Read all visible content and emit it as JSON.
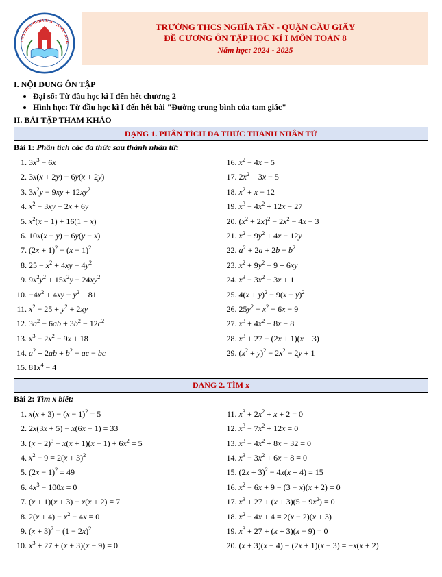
{
  "header": {
    "school_line": "TRƯỜNG THCS NGHĨA TÂN -  QUẬN CẦU GIẤY",
    "doc_line": "ĐỀ CƯƠNG ÔN TẬP HỌC KÌ I MÔN TOÁN 8",
    "year_line": "Năm học: 2024 - 2025",
    "logo_text_top": "TRƯỜNG THCS NGHĨA TÂN - QUẬN CẦU GIẤY"
  },
  "sections": {
    "s1_title": "I. NỘI DUNG ÔN TẬP",
    "s1_bullets": [
      "Đại số: Từ đầu học kì I đến hết chương 2",
      "Hình học: Từ đầu học kì I đến hết bài \"Đường trung bình của tam giác\""
    ],
    "s2_title": "II. BÀI TẬP THAM KHẢO"
  },
  "dang1": {
    "bar": "DẠNG 1. PHÂN TÍCH ĐA THỨC THÀNH NHÂN TỬ",
    "bai_label": "Bài 1:",
    "bai_text": "Phân tích các đa thức sau thành nhân tử:",
    "left": [
      "3x³ − 6x",
      "3x(x + 2y) − 6y(x + 2y)",
      "3x²y − 9xy + 12xy²",
      "x² − 3xy − 2x + 6y",
      "x²(x − 1) + 16(1 − x)",
      "10x(x − y) − 6y(y − x)",
      "(2x + 1)² − (x − 1)²",
      "25 − x² + 4xy − 4y²",
      "9x²y² + 15x²y − 24xy²",
      "−4x² + 4xy − y² + 81",
      "x² − 25 + y² + 2xy",
      "3a² − 6ab + 3b² − 12c²",
      "x³ − 2x² − 9x + 18",
      "a² + 2ab + b² − ac − bc",
      "81x⁴ − 4"
    ],
    "right_start": 16,
    "right": [
      "x² − 4x − 5",
      "2x² + 3x − 5",
      "x² + x − 12",
      "x³ − 4x² + 12x − 27",
      "(x² + 2x)² − 2x² − 4x − 3",
      "x² − 9y² + 4x − 12y",
      "a² + 2a + 2b − b²",
      "x² + 9y² − 9 + 6xy",
      "x³ − 3x² − 3x + 1",
      "4(x + y)² − 9(x − y)²",
      "25y² − x² − 6x − 9",
      "x³ + 4x² − 8x − 8",
      "x³ + 27 − (2x + 1)(x + 3)",
      "(x² + y)² − 2x² − 2y + 1"
    ]
  },
  "dang2": {
    "bar": "DẠNG 2. TÌM  x",
    "bai_label": "Bài 2:",
    "bai_text": "Tìm x biết:",
    "left": [
      "x(x + 3) − (x − 1)² = 5",
      "2x(3x + 5) − x(6x − 1) = 33",
      "(x − 2)³ − x(x + 1)(x − 1) + 6x² = 5",
      "x² − 9 = 2(x + 3)²",
      "(2x − 1)² = 49",
      "4x³ − 100x = 0",
      "(x + 1)(x + 3) − x(x + 2) = 7",
      "2(x + 4) − x² − 4x = 0",
      "(x + 3)² = (1 − 2x)²",
      "x³ + 27 + (x + 3)(x − 9) = 0"
    ],
    "right_start": 11,
    "right": [
      "x³ + 2x² + x + 2 = 0",
      "x³ − 7x² + 12x = 0",
      "x³ − 4x² + 8x − 32 = 0",
      "x³ − 3x² + 6x − 8 = 0",
      "(2x + 3)² − 4x(x + 4) = 15",
      "x² − 6x + 9 − (3 − x)(x + 2) = 0",
      "x³ + 27 + (x + 3)(5 − 9x²) = 0",
      "x² − 4x + 4 = 2(x − 2)(x + 3)",
      "x³ + 27 + (x + 3)(x − 9) = 0",
      "(x + 3)(x − 4) − (2x + 1)(x − 3) = −x(x + 2)"
    ]
  }
}
